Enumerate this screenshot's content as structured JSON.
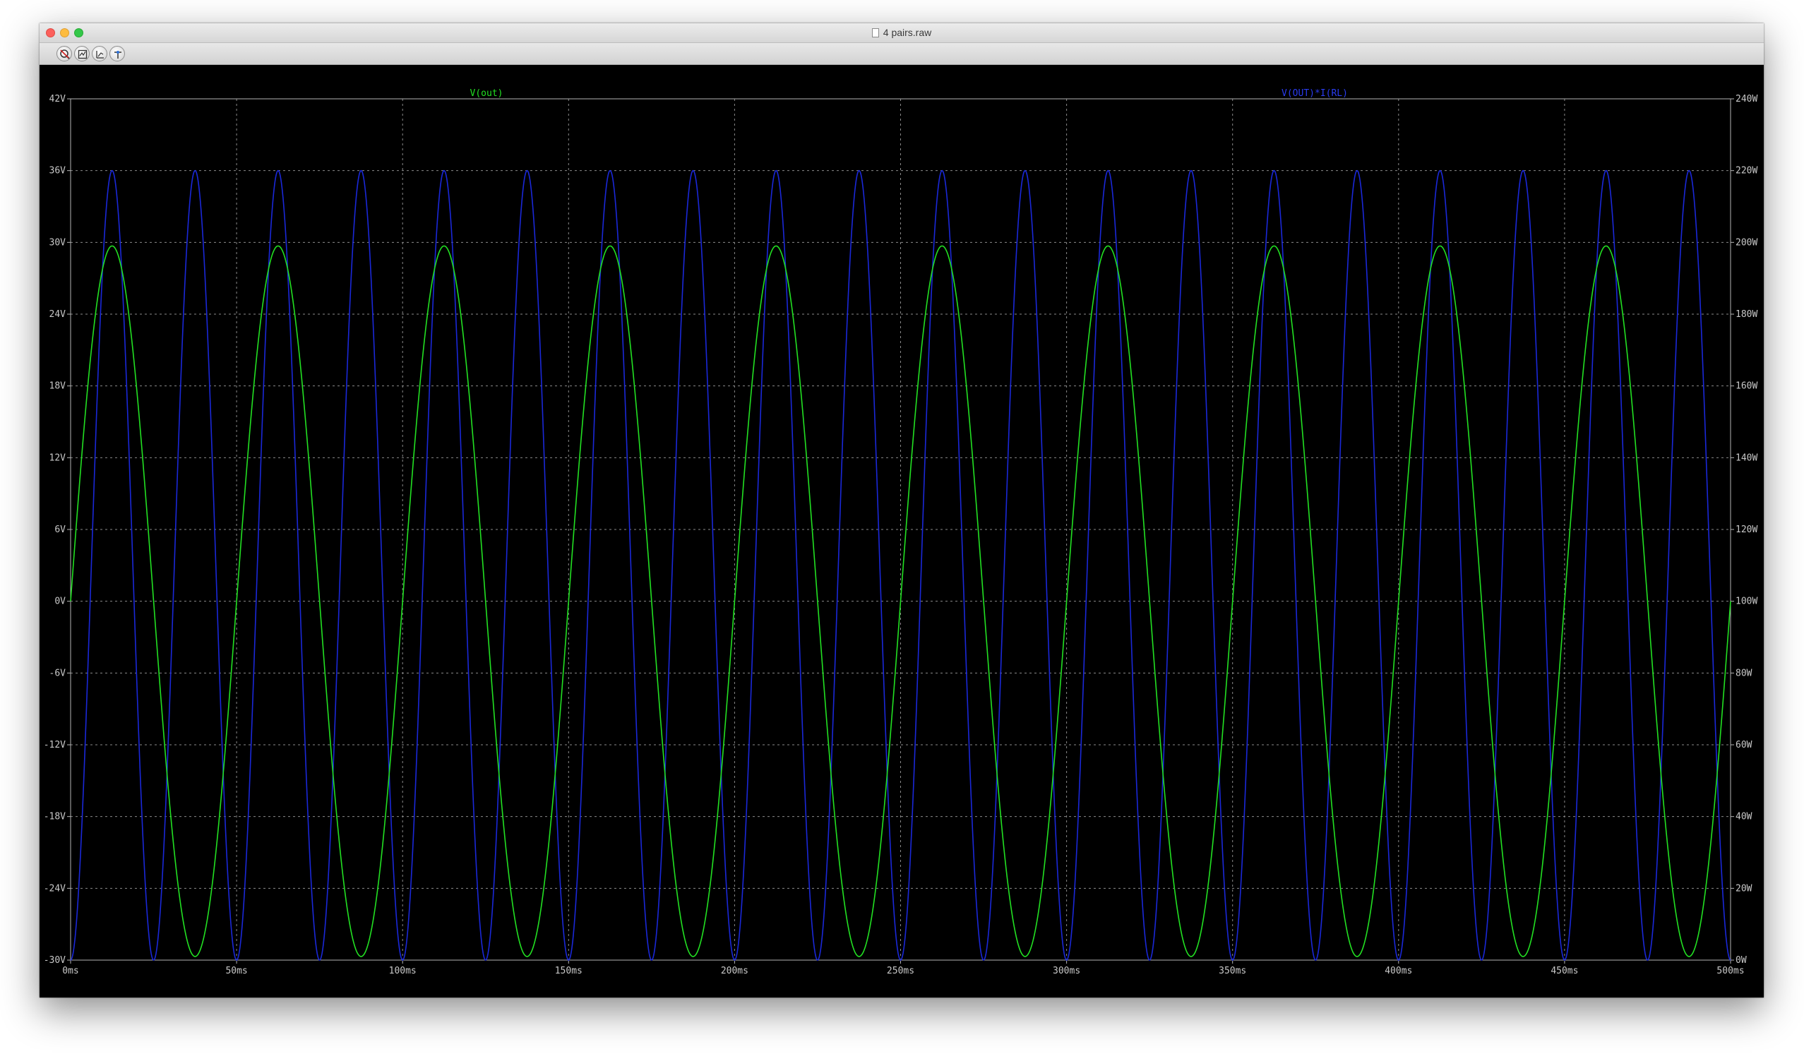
{
  "window": {
    "title": "4 pairs.raw"
  },
  "toolbar": {
    "tools": [
      {
        "icon": "zoom-cancel-icon"
      },
      {
        "icon": "autorange-icon"
      },
      {
        "icon": "zoom-fit-icon"
      },
      {
        "icon": "pan-icon"
      }
    ]
  },
  "colors": {
    "background": "#000000",
    "grid": "#8a8a8a",
    "trace_vout": "#22e022",
    "trace_power": "#1a28d8",
    "tick_text": "#c8c8c8"
  },
  "chart_data": {
    "type": "line",
    "x": {
      "range": [
        0,
        500
      ],
      "ticks": [
        0,
        50,
        100,
        150,
        200,
        250,
        300,
        350,
        400,
        450,
        500
      ],
      "tick_labels": [
        "0ms",
        "50ms",
        "100ms",
        "150ms",
        "200ms",
        "250ms",
        "300ms",
        "350ms",
        "400ms",
        "450ms",
        "500ms"
      ]
    },
    "y_left": {
      "range": [
        -30,
        42
      ],
      "ticks": [
        -30,
        -24,
        -18,
        -12,
        -6,
        0,
        6,
        12,
        18,
        24,
        30,
        36,
        42
      ],
      "tick_labels": [
        "-30V",
        "-24V",
        "-18V",
        "-12V",
        "-6V",
        "0V",
        "6V",
        "12V",
        "18V",
        "24V",
        "30V",
        "36V",
        "42V"
      ]
    },
    "y_right": {
      "range": [
        0,
        240
      ],
      "ticks": [
        0,
        20,
        40,
        60,
        80,
        100,
        120,
        140,
        160,
        180,
        200,
        220,
        240
      ],
      "tick_labels": [
        "0W",
        "20W",
        "40W",
        "60W",
        "80W",
        "100W",
        "120W",
        "140W",
        "160W",
        "180W",
        "200W",
        "220W",
        "240W"
      ]
    },
    "grid": true,
    "series": [
      {
        "name": "V(out)",
        "axis": "left",
        "waveform": "sine",
        "frequency_hz": 20,
        "amplitude": 29.7,
        "offset": 0,
        "duration_ms": 500
      },
      {
        "name": "V(OUT)*I(RL)",
        "axis": "right",
        "waveform": "sine-squared",
        "frequency_hz": 20,
        "peak": 220,
        "min": 0,
        "duration_ms": 500
      }
    ]
  }
}
